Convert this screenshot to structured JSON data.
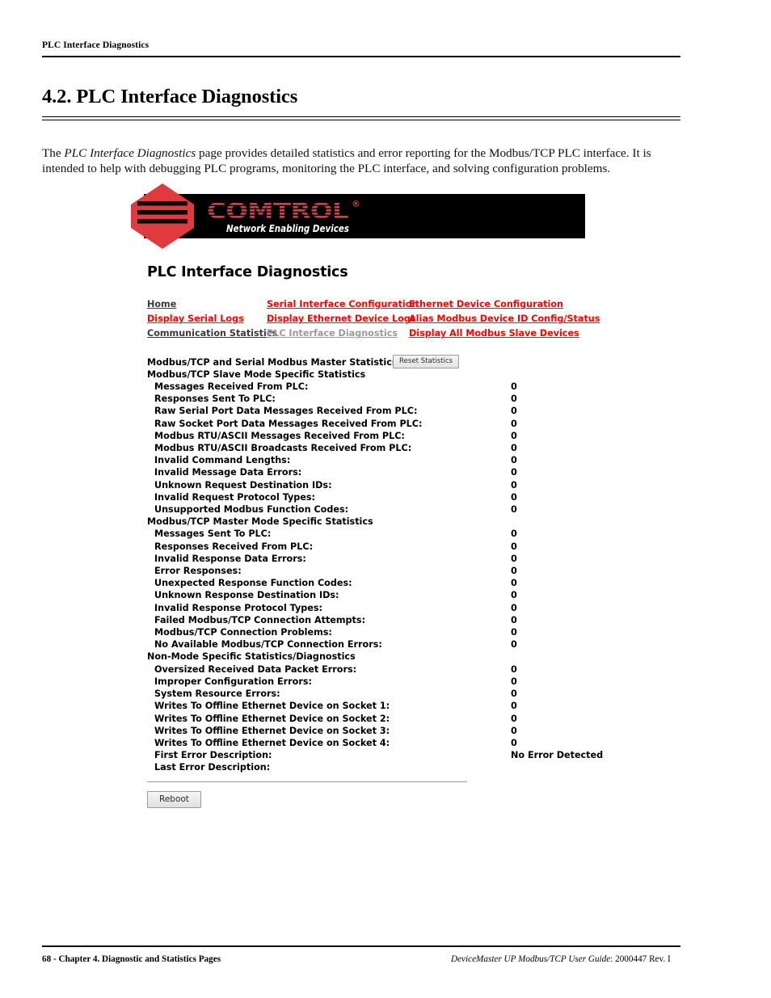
{
  "document": {
    "running_head": "PLC Interface Diagnostics",
    "section_title": "4.2. PLC Interface Diagnostics",
    "body_prefix": "The ",
    "body_italic": "PLC Interface Diagnostics",
    "body_suffix": " page provides detailed statistics and error reporting for the Modbus/TCP PLC interface. It is intended to help with debugging PLC programs, monitoring the PLC interface, and solving configuration problems.",
    "footer_left": "68 - Chapter 4. Diagnostic and Statistics Pages",
    "footer_right_italic": "DeviceMaster UP Modbus/TCP User Guide",
    "footer_right_rest": ": 2000447 Rev. I"
  },
  "screenshot": {
    "banner": {
      "brand": "COMTROL",
      "registered": "®",
      "tagline": "Network Enabling Devices",
      "brand_color": "#e03a3e",
      "background": "#000000"
    },
    "page_title": "PLC Interface Diagnostics",
    "nav": {
      "rows": [
        [
          {
            "label": "Home",
            "style": "dark"
          },
          {
            "label": "Serial Interface Configuration",
            "style": "red"
          },
          {
            "label": "Ethernet Device Configuration",
            "style": "red"
          }
        ],
        [
          {
            "label": "Display Serial Logs",
            "style": "red"
          },
          {
            "label": "Display Ethernet Device Logs",
            "style": "red"
          },
          {
            "label": "Alias Modbus Device ID Config/Status",
            "style": "red"
          }
        ],
        [
          {
            "label": "Communication Statistics",
            "style": "dark"
          },
          {
            "label": "PLC Interface Diagnostics",
            "style": "gray"
          },
          {
            "label": "Display All Modbus Slave Devices",
            "style": "red"
          }
        ]
      ]
    },
    "stats": {
      "main_heading": "Modbus/TCP and Serial Modbus Master Statistics",
      "reset_button": "Reset Statistics",
      "groups": [
        {
          "heading": "Modbus/TCP Slave Mode Specific Statistics",
          "rows": [
            {
              "label": "Messages Received From PLC:",
              "value": "0",
              "wide": false
            },
            {
              "label": "Responses Sent To PLC:",
              "value": "0",
              "wide": false
            },
            {
              "label": "Raw Serial Port Data Messages Received From PLC:",
              "value": "0",
              "wide": true
            },
            {
              "label": "Raw Socket Port Data Messages Received From PLC:",
              "value": "0",
              "wide": true
            },
            {
              "label": "Modbus RTU/ASCII Messages Received From PLC:",
              "value": "0",
              "wide": true
            },
            {
              "label": "Modbus RTU/ASCII Broadcasts Received From PLC:",
              "value": "0",
              "wide": true
            },
            {
              "label": "Invalid Command Lengths:",
              "value": "0",
              "wide": false
            },
            {
              "label": "Invalid Message Data Errors:",
              "value": "0",
              "wide": false
            },
            {
              "label": "Unknown Request Destination IDs:",
              "value": "0",
              "wide": false
            },
            {
              "label": "Invalid Request Protocol Types:",
              "value": "0",
              "wide": false
            },
            {
              "label": "Unsupported Modbus Function Codes:",
              "value": "0",
              "wide": false
            }
          ]
        },
        {
          "heading": "Modbus/TCP Master Mode Specific Statistics",
          "rows": [
            {
              "label": "Messages Sent To PLC:",
              "value": "0",
              "wide": false
            },
            {
              "label": "Responses Received From PLC:",
              "value": "0",
              "wide": false
            },
            {
              "label": "Invalid Response Data Errors:",
              "value": "0",
              "wide": false
            },
            {
              "label": "Error Responses:",
              "value": "0",
              "wide": false
            },
            {
              "label": "Unexpected Response Function Codes:",
              "value": "0",
              "wide": false
            },
            {
              "label": "Unknown Response Destination IDs:",
              "value": "0",
              "wide": false
            },
            {
              "label": "Invalid Response Protocol Types:",
              "value": "0",
              "wide": false
            },
            {
              "label": "Failed Modbus/TCP Connection Attempts:",
              "value": "0",
              "wide": false
            },
            {
              "label": "Modbus/TCP Connection Problems:",
              "value": "0",
              "wide": false
            },
            {
              "label": "No Available Modbus/TCP Connection Errors:",
              "value": "0",
              "wide": false
            }
          ]
        },
        {
          "heading": "Non-Mode Specific Statistics/Diagnostics",
          "rows": [
            {
              "label": "Oversized Received Data Packet Errors:",
              "value": "0",
              "wide": false
            },
            {
              "label": "Improper Configuration Errors:",
              "value": "0",
              "wide": false
            },
            {
              "label": "System Resource Errors:",
              "value": "0",
              "wide": false
            },
            {
              "label": "Writes To Offline Ethernet Device on Socket 1:",
              "value": "0",
              "wide": false
            },
            {
              "label": "Writes To Offline Ethernet Device on Socket 2:",
              "value": "0",
              "wide": false
            },
            {
              "label": "Writes To Offline Ethernet Device on Socket 3:",
              "value": "0",
              "wide": false
            },
            {
              "label": "Writes To Offline Ethernet Device on Socket 4:",
              "value": "0",
              "wide": false
            },
            {
              "label": "First Error Description:",
              "value": "No Error Detected",
              "wide": false
            },
            {
              "label": "Last Error Description:",
              "value": "",
              "wide": false
            }
          ]
        }
      ],
      "reboot_button": "Reboot"
    }
  }
}
